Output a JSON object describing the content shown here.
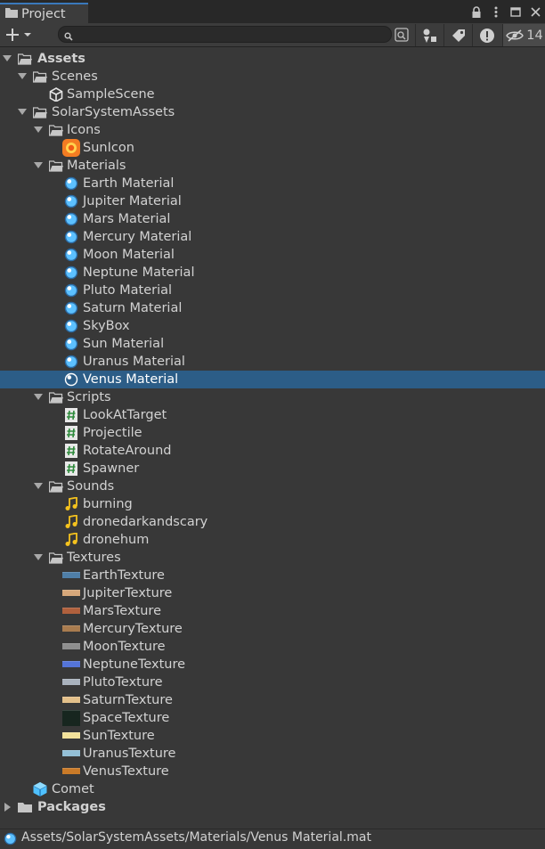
{
  "window": {
    "tab_label": "Project"
  },
  "toolbar": {
    "search": {
      "value": "",
      "placeholder": ""
    },
    "hidden_count": "14"
  },
  "tree": [
    {
      "label": "Assets",
      "depth": 0,
      "icon": "folder-open-icon",
      "fold": "down",
      "bold": true
    },
    {
      "label": "Scenes",
      "depth": 1,
      "icon": "folder-open-icon",
      "fold": "down"
    },
    {
      "label": "SampleScene",
      "depth": 2,
      "icon": "unity-scene-icon",
      "fold": "none"
    },
    {
      "label": "SolarSystemAssets",
      "depth": 1,
      "icon": "folder-open-icon",
      "fold": "down"
    },
    {
      "label": "Icons",
      "depth": 2,
      "icon": "folder-open-icon",
      "fold": "down"
    },
    {
      "label": "SunIcon",
      "depth": 3,
      "icon": "sun-image-icon",
      "fold": "none"
    },
    {
      "label": "Materials",
      "depth": 2,
      "icon": "folder-open-icon",
      "fold": "down"
    },
    {
      "label": "Earth Material",
      "depth": 3,
      "icon": "material-sphere-icon",
      "fold": "none"
    },
    {
      "label": "Jupiter Material",
      "depth": 3,
      "icon": "material-sphere-icon",
      "fold": "none"
    },
    {
      "label": "Mars Material",
      "depth": 3,
      "icon": "material-sphere-icon",
      "fold": "none"
    },
    {
      "label": "Mercury Material",
      "depth": 3,
      "icon": "material-sphere-icon",
      "fold": "none"
    },
    {
      "label": "Moon Material",
      "depth": 3,
      "icon": "material-sphere-icon",
      "fold": "none"
    },
    {
      "label": "Neptune Material",
      "depth": 3,
      "icon": "material-sphere-icon",
      "fold": "none"
    },
    {
      "label": "Pluto Material",
      "depth": 3,
      "icon": "material-sphere-icon",
      "fold": "none"
    },
    {
      "label": "Saturn Material",
      "depth": 3,
      "icon": "material-sphere-icon",
      "fold": "none"
    },
    {
      "label": "SkyBox",
      "depth": 3,
      "icon": "material-sphere-icon",
      "fold": "none"
    },
    {
      "label": "Sun Material",
      "depth": 3,
      "icon": "material-sphere-icon",
      "fold": "none"
    },
    {
      "label": "Uranus Material",
      "depth": 3,
      "icon": "material-sphere-icon",
      "fold": "none"
    },
    {
      "label": "Venus Material",
      "depth": 3,
      "icon": "material-sphere-icon",
      "fold": "none",
      "selected": true
    },
    {
      "label": "Scripts",
      "depth": 2,
      "icon": "folder-open-icon",
      "fold": "down"
    },
    {
      "label": "LookAtTarget",
      "depth": 3,
      "icon": "csharp-script-icon",
      "fold": "none"
    },
    {
      "label": "Projectile",
      "depth": 3,
      "icon": "csharp-script-icon",
      "fold": "none"
    },
    {
      "label": "RotateAround",
      "depth": 3,
      "icon": "csharp-script-icon",
      "fold": "none"
    },
    {
      "label": "Spawner",
      "depth": 3,
      "icon": "csharp-script-icon",
      "fold": "none"
    },
    {
      "label": "Sounds",
      "depth": 2,
      "icon": "folder-open-icon",
      "fold": "down"
    },
    {
      "label": "burning",
      "depth": 3,
      "icon": "audio-clip-icon",
      "fold": "none"
    },
    {
      "label": "dronedarkandscary",
      "depth": 3,
      "icon": "audio-clip-icon",
      "fold": "none"
    },
    {
      "label": "dronehum",
      "depth": 3,
      "icon": "audio-clip-icon",
      "fold": "none"
    },
    {
      "label": "Textures",
      "depth": 2,
      "icon": "folder-open-icon",
      "fold": "down"
    },
    {
      "label": "EarthTexture",
      "depth": 3,
      "icon": "texture-thumbnail-icon",
      "fold": "none",
      "swatch": "#4f7fa8"
    },
    {
      "label": "JupiterTexture",
      "depth": 3,
      "icon": "texture-thumbnail-icon",
      "fold": "none",
      "swatch": "#d6a77a"
    },
    {
      "label": "MarsTexture",
      "depth": 3,
      "icon": "texture-thumbnail-icon",
      "fold": "none",
      "swatch": "#b0603d"
    },
    {
      "label": "MercuryTexture",
      "depth": 3,
      "icon": "texture-thumbnail-icon",
      "fold": "none",
      "swatch": "#a97c4f"
    },
    {
      "label": "MoonTexture",
      "depth": 3,
      "icon": "texture-thumbnail-icon",
      "fold": "none",
      "swatch": "#8e8e8e"
    },
    {
      "label": "NeptuneTexture",
      "depth": 3,
      "icon": "texture-thumbnail-icon",
      "fold": "none",
      "swatch": "#5474d8"
    },
    {
      "label": "PlutoTexture",
      "depth": 3,
      "icon": "texture-thumbnail-icon",
      "fold": "none",
      "swatch": "#a9b2bd"
    },
    {
      "label": "SaturnTexture",
      "depth": 3,
      "icon": "texture-thumbnail-icon",
      "fold": "none",
      "swatch": "#e3c08a"
    },
    {
      "label": "SpaceTexture",
      "depth": 3,
      "icon": "texture-thumbnail-icon",
      "fold": "none",
      "swatch": "#17261f",
      "tall": true
    },
    {
      "label": "SunTexture",
      "depth": 3,
      "icon": "texture-thumbnail-icon",
      "fold": "none",
      "swatch": "#f2e19a"
    },
    {
      "label": "UranusTexture",
      "depth": 3,
      "icon": "texture-thumbnail-icon",
      "fold": "none",
      "swatch": "#93bfd6"
    },
    {
      "label": "VenusTexture",
      "depth": 3,
      "icon": "texture-thumbnail-icon",
      "fold": "none",
      "swatch": "#c97a28"
    },
    {
      "label": "Comet",
      "depth": 1,
      "icon": "prefab-cube-icon",
      "fold": "none"
    },
    {
      "label": "Packages",
      "depth": 0,
      "icon": "folder-closed-icon",
      "fold": "right",
      "bold": true
    }
  ],
  "statusbar": {
    "path": "Assets/SolarSystemAssets/Materials/Venus Material.mat"
  }
}
